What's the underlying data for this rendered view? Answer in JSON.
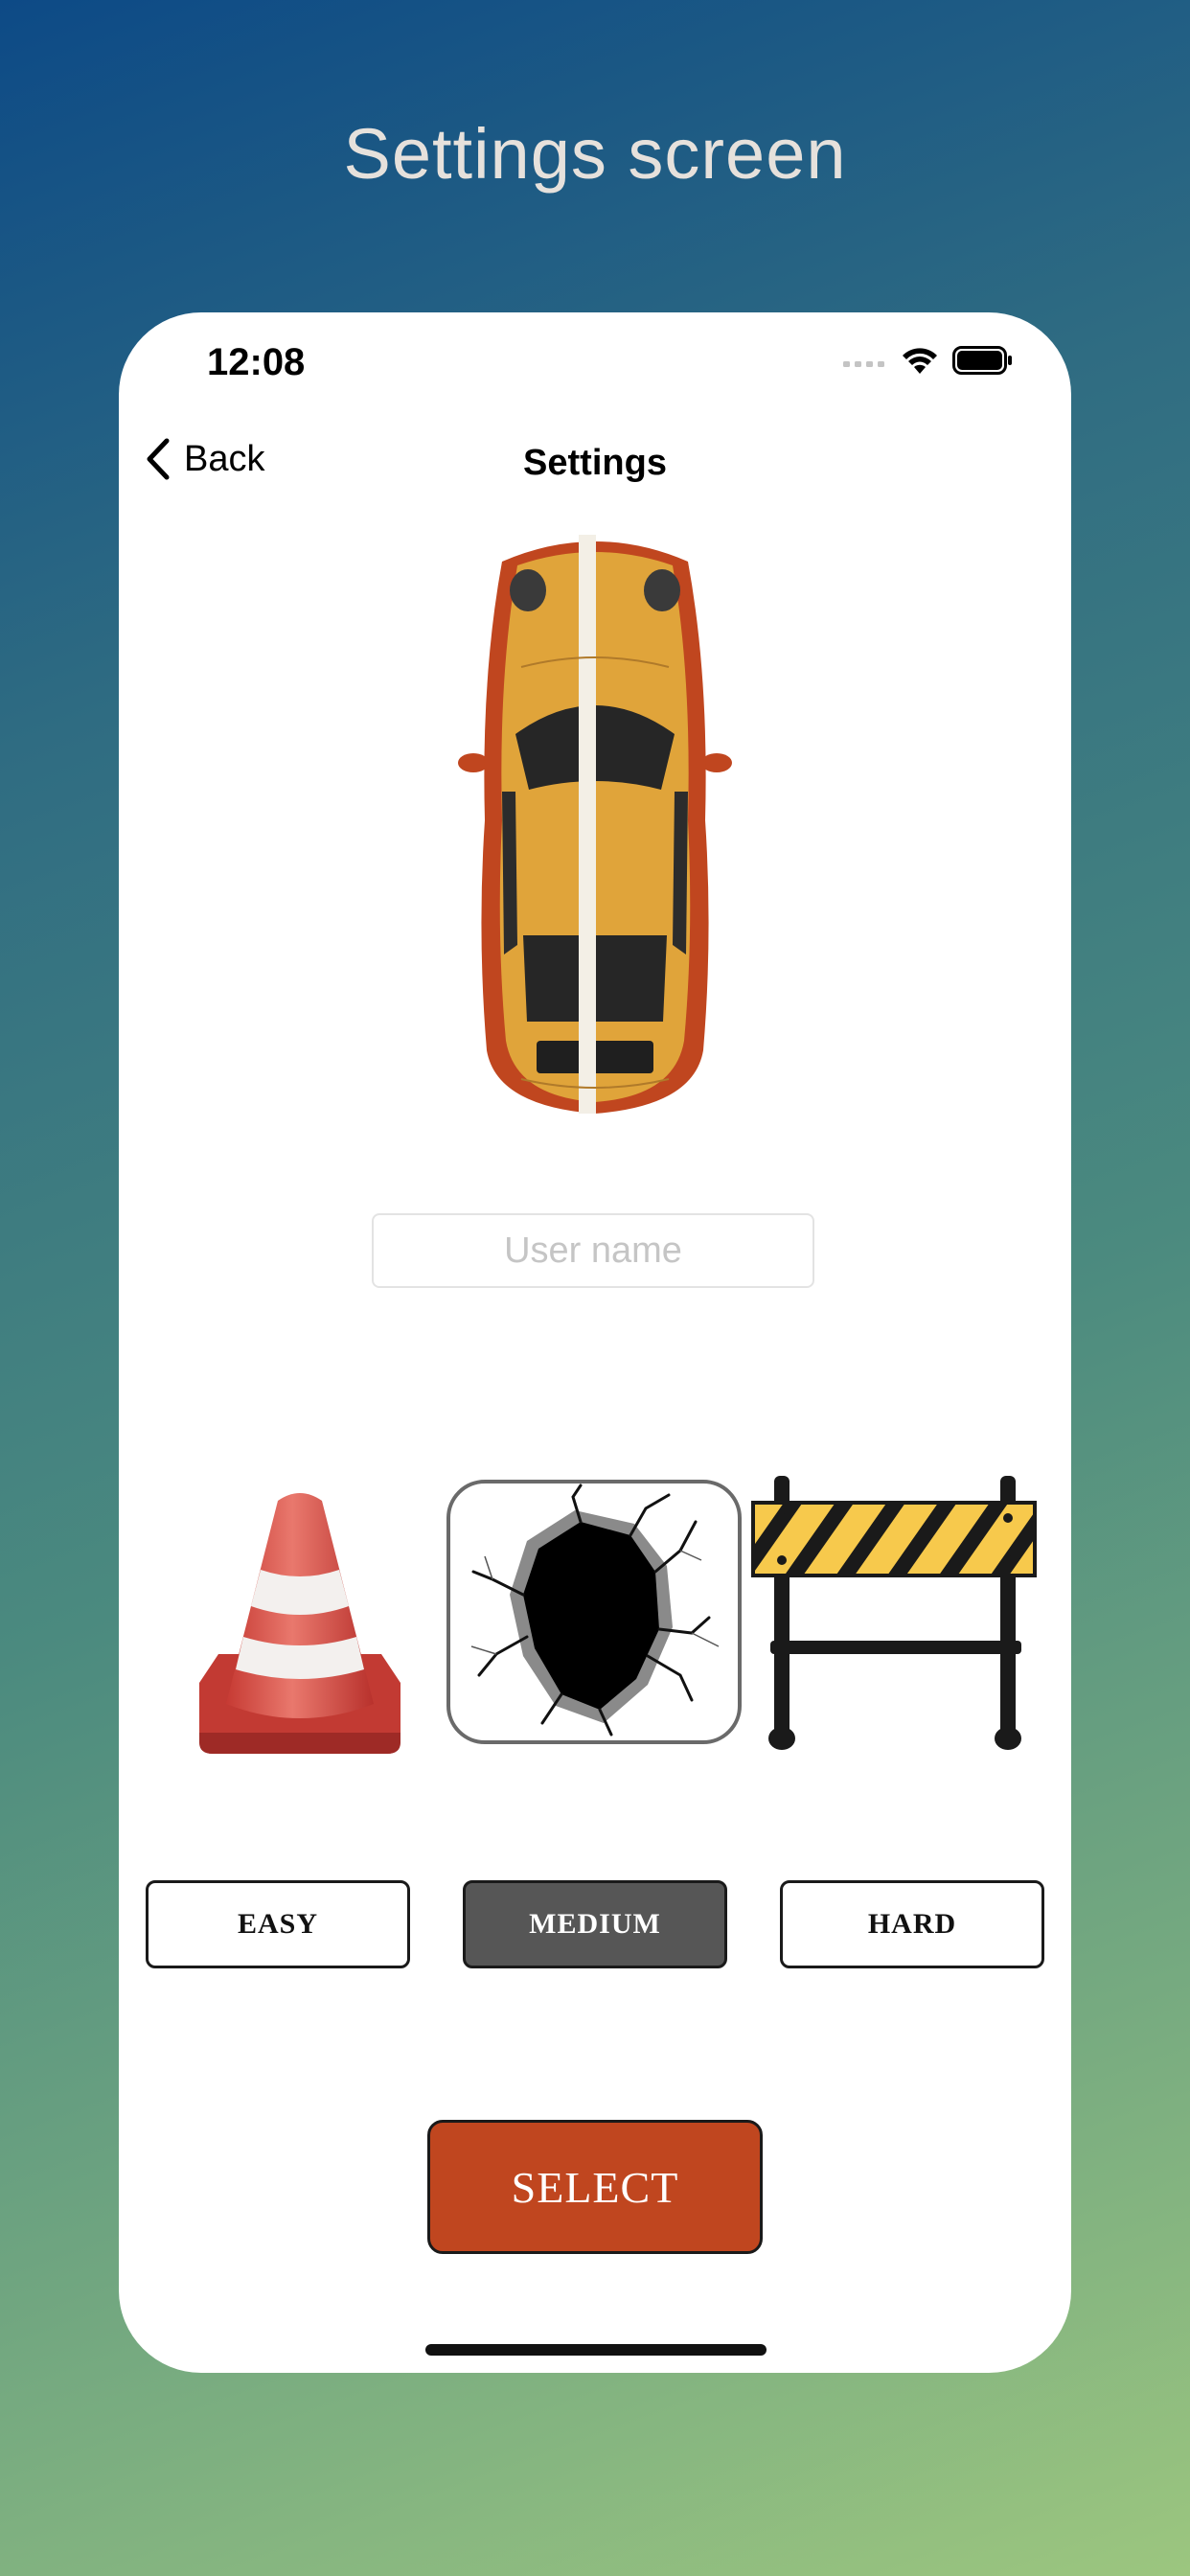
{
  "page": {
    "title": "Settings screen"
  },
  "status_bar": {
    "time": "12:08"
  },
  "nav": {
    "back_label": "Back",
    "title": "Settings"
  },
  "username": {
    "placeholder": "User name",
    "value": ""
  },
  "difficulty": {
    "options": [
      {
        "label": "EASY",
        "icon": "traffic-cone-icon"
      },
      {
        "label": "MEDIUM",
        "icon": "cracked-hole-icon"
      },
      {
        "label": "HARD",
        "icon": "road-barrier-icon"
      }
    ],
    "selected": "MEDIUM"
  },
  "select_button": {
    "label": "SELECT"
  },
  "colors": {
    "select_button": "#c0461f",
    "selected_difficulty": "#565656",
    "car_body": "#e0a43a",
    "car_side": "#c0461f"
  }
}
